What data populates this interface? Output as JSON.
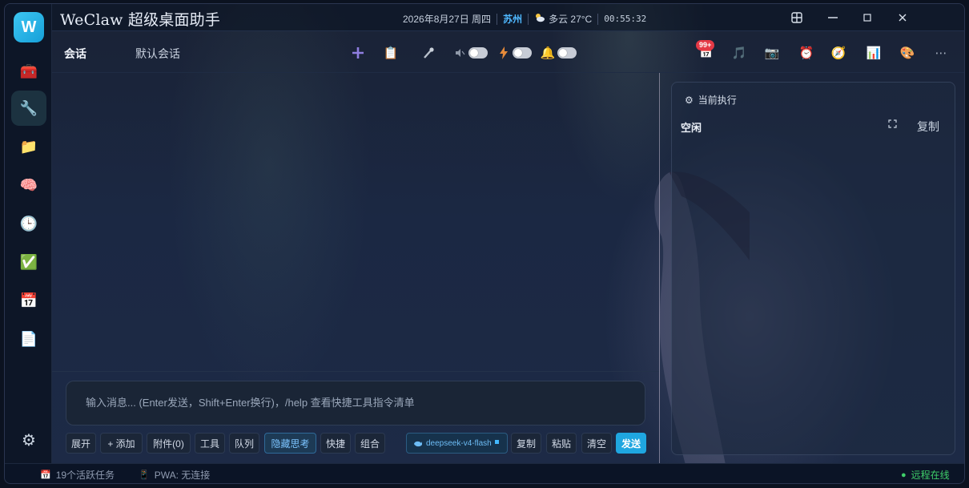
{
  "app": {
    "logo_letter": "W",
    "title": "WeClaw 超级桌面助手"
  },
  "status": {
    "date": "2026年8月27日 周四",
    "city": "苏州",
    "weather_icon": "partly-cloudy-icon",
    "weather": "多云 27°C",
    "time": "00:55:32"
  },
  "window_controls": [
    "layout-icon",
    "minimize-icon",
    "maximize-icon",
    "close-icon"
  ],
  "sidebar": {
    "items": [
      {
        "name": "toolbox-icon",
        "glyph": "🧰"
      },
      {
        "name": "wrench-icon",
        "glyph": "🔧",
        "active": true
      },
      {
        "name": "folder-icon",
        "glyph": "📁"
      },
      {
        "name": "brain-icon",
        "glyph": "🧠"
      },
      {
        "name": "clock-icon",
        "glyph": "🕒"
      },
      {
        "name": "checkbox-icon",
        "glyph": "✅"
      },
      {
        "name": "calendar-icon",
        "glyph": "📅"
      },
      {
        "name": "document-icon",
        "glyph": "📄"
      }
    ],
    "settings_glyph": "⚙"
  },
  "nav": {
    "tab_conversation": "会话",
    "session_name": "默认会话",
    "badge": "99+"
  },
  "composer": {
    "placeholder": "输入消息... (Enter发送，Shift+Enter换行)，/help 查看快捷工具指令清单",
    "buttons": {
      "expand": "展开",
      "add": "+ 添加",
      "attachments": "附件(0)",
      "tools": "工具",
      "queue": "队列",
      "hide_thinking": "隐藏思考",
      "shortcuts": "快捷",
      "combine": "组合",
      "model": "deepseek-v4-flash",
      "copy": "复制",
      "paste": "粘贴",
      "clear": "清空",
      "send": "发送"
    }
  },
  "panel": {
    "title": "当前执行",
    "state": "空闲",
    "copy": "复制"
  },
  "statusbar": {
    "tasks": "19个活跃任务",
    "pwa": "PWA: 无连接",
    "remote": "远程在线"
  },
  "colors": {
    "accent": "#1fa6e0",
    "badge": "#e53946",
    "online": "#3fcf6a",
    "city": "#4fb8ff"
  }
}
